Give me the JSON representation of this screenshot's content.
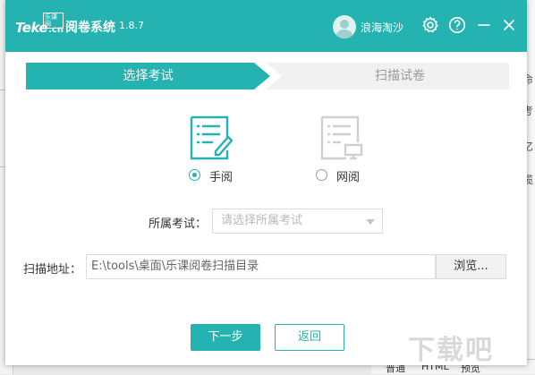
{
  "window": {
    "app_title": "阅卷系统",
    "version": "1.8.7",
    "logo": {
      "text": "Teke",
      "domain": ".cn",
      "badge": "乐课网"
    },
    "username": "浪海淘沙"
  },
  "steps": [
    {
      "label": "选择考试",
      "active": true
    },
    {
      "label": "扫描试卷",
      "active": false
    }
  ],
  "mode": {
    "options": [
      {
        "label": "手阅",
        "checked": true,
        "icon": "paper-pen-icon"
      },
      {
        "label": "网阅",
        "checked": false,
        "icon": "paper-monitor-icon"
      }
    ]
  },
  "form": {
    "exam_label": "所属考试：",
    "exam_placeholder": "请选择所属考试",
    "path_label": "扫描地址：",
    "path_value": "E:\\tools\\桌面\\乐课阅卷扫描目录",
    "browse_label": "浏览..."
  },
  "buttons": {
    "next": "下一步",
    "back": "返回"
  },
  "background": {
    "right_fragments": [
      "命",
      "考",
      "亿",
      "缆"
    ],
    "bottom_fragments": [
      "普通",
      "HTML",
      "预览"
    ],
    "watermark": "下载吧"
  },
  "colors": {
    "accent": "#24b3b0",
    "inactive_step": "#f1f1f1"
  }
}
